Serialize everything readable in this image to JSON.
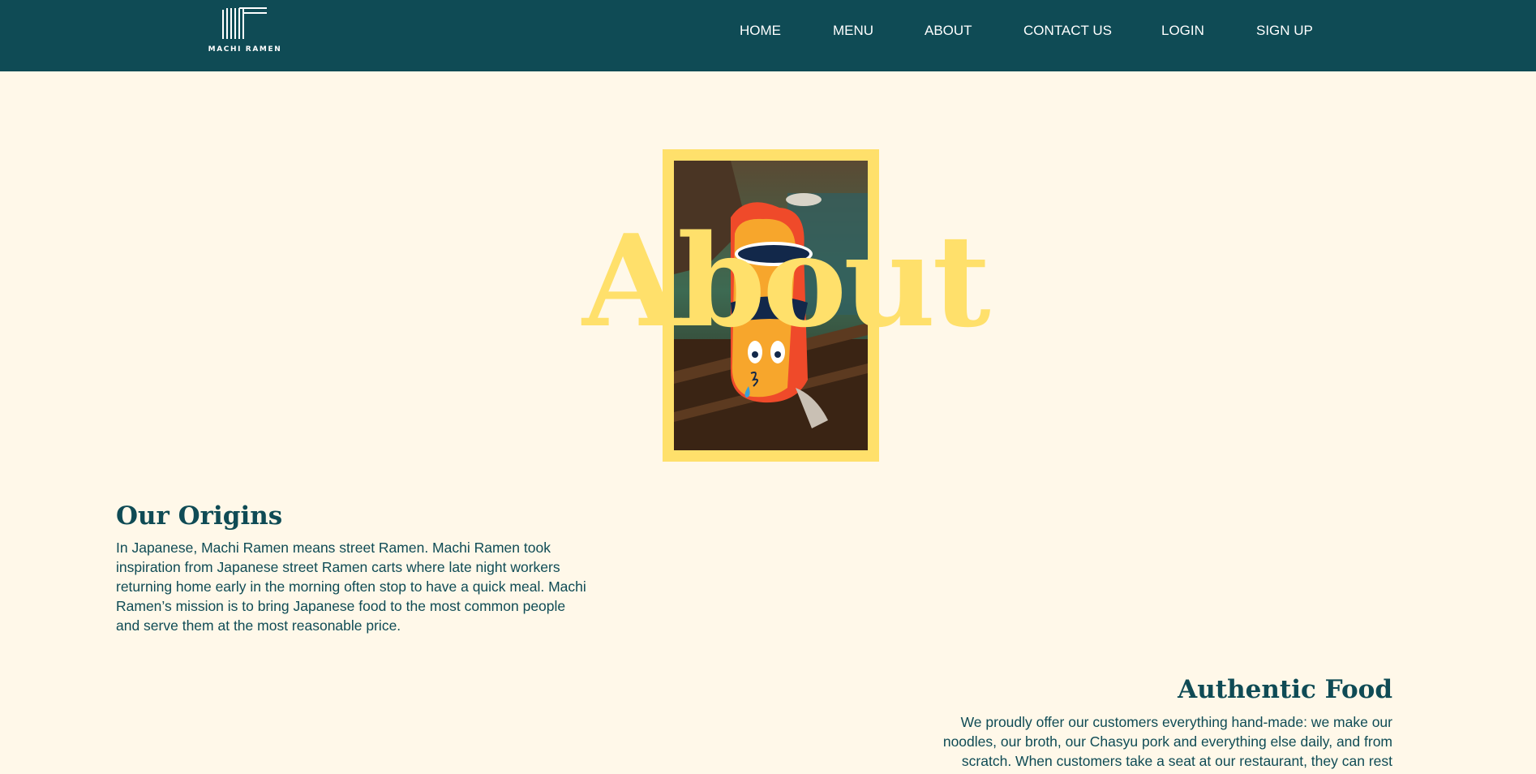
{
  "brand": {
    "logo_text": "MACHI RAMEN"
  },
  "nav": {
    "items": [
      "HOME",
      "MENU",
      "ABOUT",
      "CONTACT US",
      "LOGIN",
      "SIGN UP"
    ]
  },
  "hero": {
    "title": "About"
  },
  "sections": [
    {
      "heading": "Our Origins",
      "body": "In Japanese, Machi Ramen means street Ramen. Machi Ramen took inspiration from Japanese street Ramen carts where late night workers returning home early in the morning often stop to have a quick meal. Machi Ramen’s mission is to bring Japanese food to the most common people and serve them at the most reasonable price."
    },
    {
      "heading": "Authentic Food",
      "body": "We proudly offer our customers everything hand-made: we make our noodles, our broth, our Chasyu pork and everything else daily, and from scratch. When customers take a seat at our restaurant, they can rest"
    }
  ],
  "colors": {
    "header_bg": "#0f4b55",
    "page_bg": "#fff8e9",
    "accent_yellow": "#ffe06b",
    "text_teal": "#0f4b55"
  }
}
